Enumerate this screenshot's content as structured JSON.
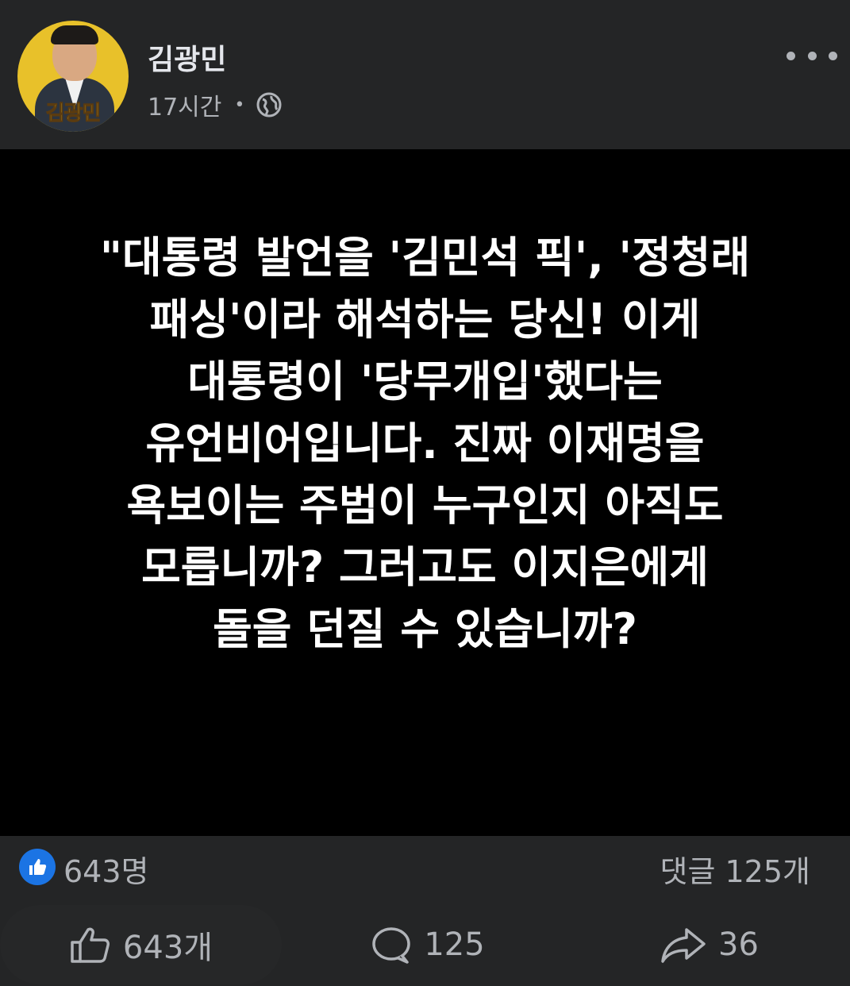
{
  "author": {
    "name": "김광민",
    "avatar_label": "김광민",
    "time": "17시간",
    "separator": "•",
    "privacy_icon": "globe-icon"
  },
  "header": {
    "more_icon": "more-horizontal-icon"
  },
  "post_image": {
    "lines": [
      "\"대통령 발언을 '김민석 픽', '정청래",
      "패싱'이라 해석하는 당신! 이게",
      "대통령이 '당무개입'했다는",
      "유언비어입니다. 진짜 이재명을",
      "욕보이는 주범이 누구인지 아직도",
      "모릅니까? 그러고도 이지은에게",
      "돌을 던질 수 있습니까?"
    ]
  },
  "summary": {
    "reaction_icon": "like-icon",
    "reaction_count": "643명",
    "comment_count": "댓글 125개"
  },
  "actions": {
    "like": {
      "icon": "thumbs-up-icon",
      "label": "643개"
    },
    "comment": {
      "icon": "comment-icon",
      "label": "125"
    },
    "share": {
      "icon": "share-icon",
      "label": "36"
    }
  },
  "colors": {
    "background": "#242526",
    "image_background": "#000000",
    "text_primary": "#e4e6eb",
    "text_secondary": "#b0b3b8",
    "like_blue": "#1b74e4",
    "avatar_yellow": "#e8c12a"
  }
}
